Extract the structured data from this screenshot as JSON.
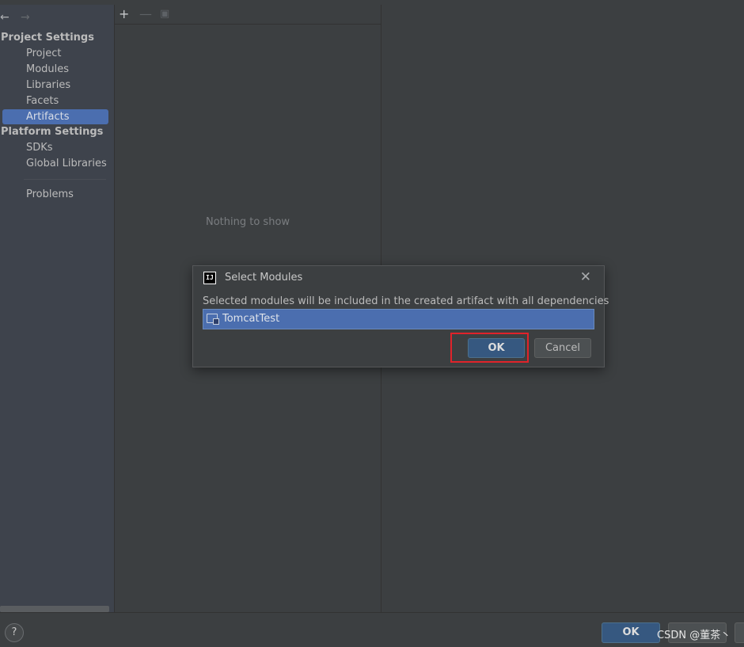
{
  "nav": {
    "back_icon": "arrow-left-icon",
    "forward_icon": "arrow-right-icon",
    "back_glyph": "←",
    "forward_glyph": "→"
  },
  "sidebar": {
    "project_settings_title": "Project Settings",
    "project_items": [
      {
        "label": "Project"
      },
      {
        "label": "Modules"
      },
      {
        "label": "Libraries"
      },
      {
        "label": "Facets"
      },
      {
        "label": "Artifacts",
        "selected": true
      }
    ],
    "platform_settings_title": "Platform Settings",
    "platform_items": [
      {
        "label": "SDKs"
      },
      {
        "label": "Global Libraries"
      }
    ],
    "problems_label": "Problems"
  },
  "list_panel": {
    "empty_text": "Nothing to show",
    "toolbar": {
      "add_glyph": "+",
      "remove_glyph": "—",
      "copy_glyph": "▣"
    }
  },
  "dialog": {
    "title": "Select Modules",
    "app_icon_text": "IJ",
    "close_glyph": "✕",
    "description": "Selected modules will be included in the created artifact with all dependencies",
    "modules": [
      {
        "name": "TomcatTest",
        "selected": true
      }
    ],
    "ok_label": "OK",
    "cancel_label": "Cancel"
  },
  "bottom_bar": {
    "help_glyph": "?",
    "ok_label": "OK",
    "watermark": "CSDN @董茶丶"
  },
  "colors": {
    "selection": "#4b6eaf",
    "default_button": "#365880",
    "highlight": "#e0232a",
    "background": "#3c3f41"
  }
}
